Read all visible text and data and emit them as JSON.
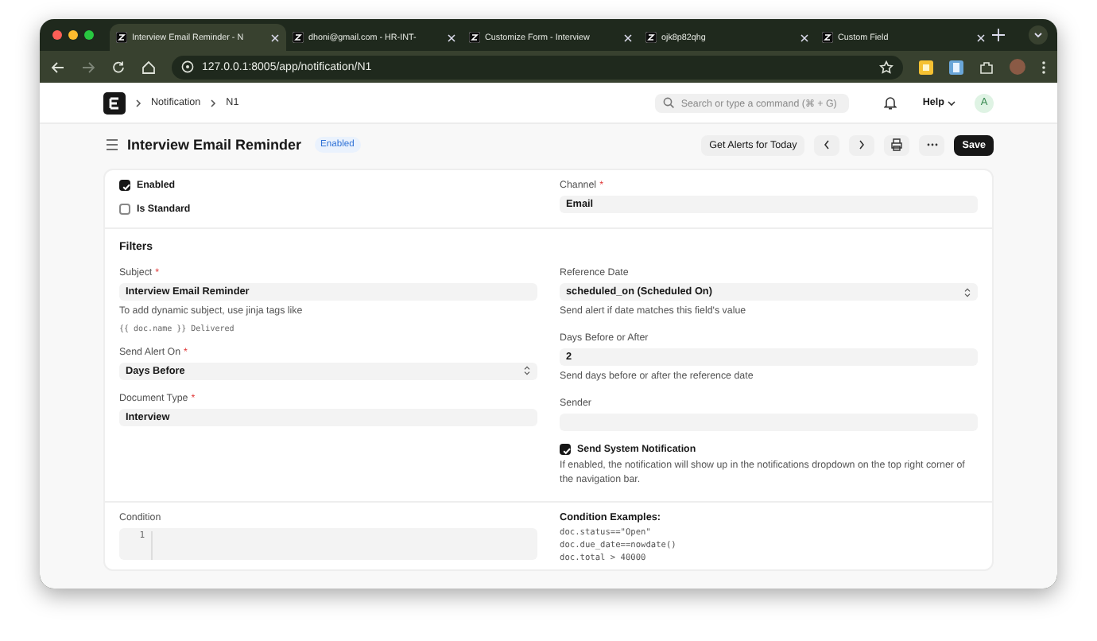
{
  "browser": {
    "tabs": [
      {
        "title": "Interview Email Reminder - N",
        "selected": true
      },
      {
        "title": "dhoni@gmail.com - HR-INT-",
        "selected": false
      },
      {
        "title": "Customize Form - Interview",
        "selected": false
      },
      {
        "title": "ojk8p82qhg",
        "selected": false
      },
      {
        "title": "Custom Field",
        "selected": false
      }
    ],
    "url": "127.0.0.1:8005/app/notification/N1"
  },
  "navbar": {
    "breadcrumbs": [
      "Notification",
      "N1"
    ],
    "search": {
      "placeholder": "Search or type a command (⌘ + G)"
    },
    "help": "Help",
    "avatar": "A"
  },
  "page_header": {
    "title": "Interview Email Reminder",
    "status": "Enabled",
    "action": "Get Alerts for Today",
    "save": "Save"
  },
  "form": {
    "top_left": [
      {
        "kind": "checkbox",
        "label": "Enabled",
        "checked": true
      },
      {
        "kind": "checkbox",
        "label": "Is Standard",
        "checked": false
      }
    ],
    "top_right": [
      {
        "kind": "input",
        "label": "Channel",
        "required_mark": "*",
        "value": "Email"
      }
    ],
    "filters": {
      "heading": "Filters",
      "left": [
        {
          "kind": "input",
          "label": "Subject",
          "required_mark": "*",
          "value": "Interview Email Reminder",
          "description": "To add dynamic subject, use jinja tags like",
          "description_code": "{{ doc.name }} Delivered"
        },
        {
          "kind": "select",
          "label": "Send Alert On",
          "required_mark": "*",
          "value": "Days Before"
        },
        {
          "kind": "input",
          "label": "Document Type",
          "required_mark": "*",
          "value": "Interview"
        }
      ],
      "right": [
        {
          "kind": "select",
          "label": "Reference Date",
          "value": "scheduled_on (Scheduled On)",
          "description": "Send alert if date matches this field's value"
        },
        {
          "kind": "input",
          "label": "Days Before or After",
          "value": "2",
          "description": "Send days before or after the reference date"
        },
        {
          "kind": "input",
          "label": "Sender"
        },
        {
          "kind": "checkbox",
          "label": "Send System Notification",
          "checked": true,
          "description": "If enabled, the notification will show up in the notifications dropdown on the top right corner of the navigation bar."
        }
      ]
    },
    "condition": {
      "label": "Condition",
      "line_numbers": [
        "1"
      ],
      "examples_heading": "Condition Examples:",
      "examples": [
        "doc.status==\"Open\"",
        "doc.due_date==nowdate()",
        "doc.total > 40000"
      ]
    }
  }
}
